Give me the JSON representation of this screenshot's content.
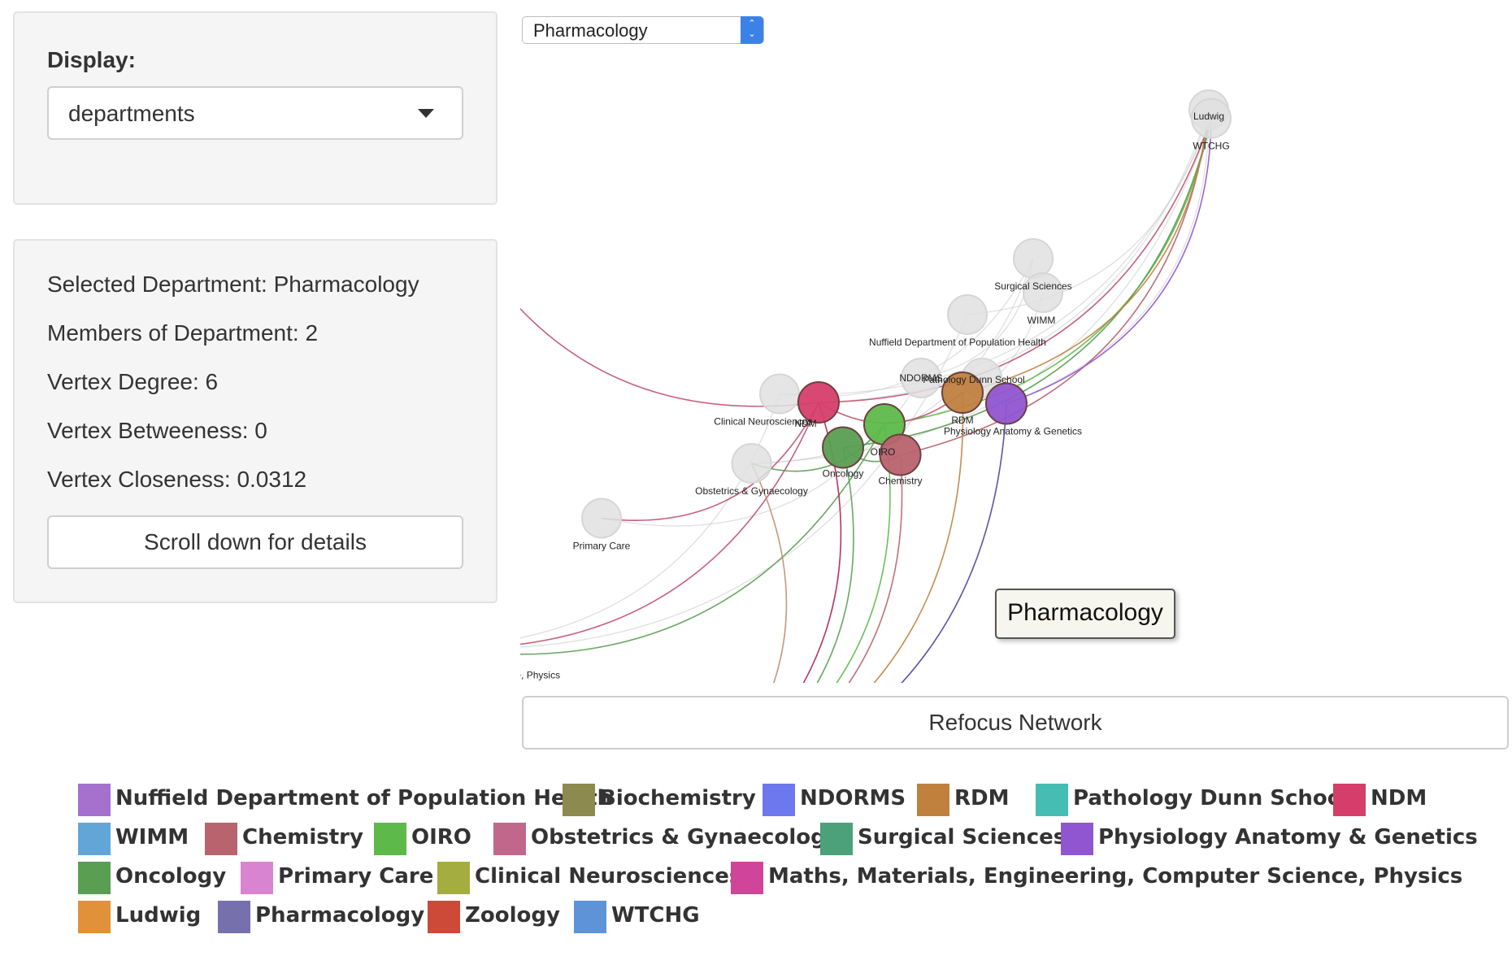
{
  "display": {
    "label": "Display:",
    "selected": "departments"
  },
  "info": {
    "selected_department": "Selected Department: Pharmacology",
    "members": "Members of Department: 2",
    "vertex_degree": "Vertex Degree: 6",
    "vertex_betweenness": "Vertex Betweeness: 0",
    "vertex_closeness": "Vertex Closeness: 0.0312",
    "scroll_button": "Scroll down for details"
  },
  "department_select": {
    "selected": "Pharmacology",
    "stepper_icon": "up-down-chevron-icon"
  },
  "network": {
    "nodes": [
      {
        "name": "Ludwig",
        "label": "Ludwig",
        "color": "#e0e0e0"
      },
      {
        "name": "WTCHG",
        "label": "WTCHG",
        "color": "#e0e0e0"
      },
      {
        "name": "Zoology",
        "label": "Zoology",
        "color": "#e0e0e0"
      },
      {
        "name": "Surgical Sciences",
        "label": "Surgical Sciences",
        "color": "#e0e0e0"
      },
      {
        "name": "WIMM",
        "label": "WIMM",
        "color": "#e0e0e0"
      },
      {
        "name": "Nuffield Department of Population Health",
        "label": "Nuffield Department of Population Health",
        "color": "#e0e0e0"
      },
      {
        "name": "Pathology Dunn School",
        "label": "Pathology Dunn School",
        "color": "#e0e0e0"
      },
      {
        "name": "NDORMS",
        "label": "NDORMS",
        "color": "#e0e0e0"
      },
      {
        "name": "RDM",
        "label": "RDM",
        "color": "#c0813f"
      },
      {
        "name": "Physiology Anatomy & Genetics",
        "label": "Physiology Anatomy & Genetics",
        "color": "#9055d0"
      },
      {
        "name": "Clinical Neurosciences",
        "label": "Clinical Neurosciences",
        "color": "#e0e0e0"
      },
      {
        "name": "NDM",
        "label": "NDM",
        "color": "#d63e6a"
      },
      {
        "name": "OIRO",
        "label": "OIRO",
        "color": "#5db94a"
      },
      {
        "name": "Oncology",
        "label": "Oncology",
        "color": "#5a9e52"
      },
      {
        "name": "Chemistry",
        "label": "Chemistry",
        "color": "#b8636e"
      },
      {
        "name": "Obstetrics & Gynaecology",
        "label": "Obstetrics & Gynaecology",
        "color": "#e0e0e0"
      },
      {
        "name": "Primary Care",
        "label": "Primary Care",
        "color": "#e0e0e0"
      },
      {
        "name": "Maths, Materials, Engineering, Computer Science, Physics",
        "label": "Maths, Materials, Engineering, Computer Science, Physics",
        "color": "#e0e0e0"
      },
      {
        "name": "Pharmacology",
        "label": "Pharmacology",
        "color": "#7670ad"
      }
    ],
    "tooltip": "Pharmacology"
  },
  "refocus_button": "Refocus Network",
  "legend": [
    {
      "label": "Nuffield Department of Population Health",
      "color": "#a670cd"
    },
    {
      "label": "Biochemistry",
      "color": "#8c8a4e"
    },
    {
      "label": "NDORMS",
      "color": "#6d78ef"
    },
    {
      "label": "RDM",
      "color": "#c0813f"
    },
    {
      "label": "Pathology Dunn School",
      "color": "#45bdb2"
    },
    {
      "label": "NDM",
      "color": "#d63e6a"
    },
    {
      "label": "WIMM",
      "color": "#62a6d8"
    },
    {
      "label": "Chemistry",
      "color": "#b8636e"
    },
    {
      "label": "OIRO",
      "color": "#5db94a"
    },
    {
      "label": "Obstetrics & Gynaecology",
      "color": "#c2678c"
    },
    {
      "label": "Surgical Sciences",
      "color": "#4ca07a"
    },
    {
      "label": "Physiology Anatomy & Genetics",
      "color": "#9055d0"
    },
    {
      "label": "Oncology",
      "color": "#5a9e52"
    },
    {
      "label": "Primary Care",
      "color": "#d884d0"
    },
    {
      "label": "Clinical Neurosciences",
      "color": "#a4ad40"
    },
    {
      "label": "Maths, Materials, Engineering, Computer Science, Physics",
      "color": "#d0449a"
    },
    {
      "label": "Ludwig",
      "color": "#e0913a"
    },
    {
      "label": "Pharmacology",
      "color": "#7670ad"
    },
    {
      "label": "Zoology",
      "color": "#cc4a37"
    },
    {
      "label": "WTCHG",
      "color": "#5f93d8"
    }
  ]
}
